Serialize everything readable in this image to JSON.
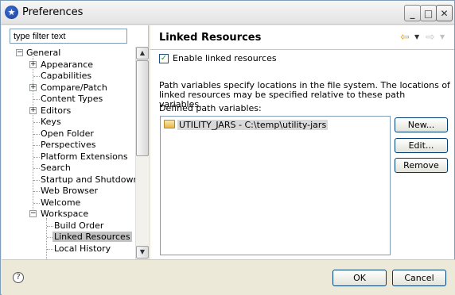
{
  "window": {
    "title": "Preferences"
  },
  "filter": {
    "value": "type filter text"
  },
  "tree": {
    "items": [
      {
        "label": "General",
        "level": 0,
        "expander": "−"
      },
      {
        "label": "Appearance",
        "level": 1,
        "expander": "+"
      },
      {
        "label": "Capabilities",
        "level": 1
      },
      {
        "label": "Compare/Patch",
        "level": 1,
        "expander": "+"
      },
      {
        "label": "Content Types",
        "level": 1
      },
      {
        "label": "Editors",
        "level": 1,
        "expander": "+"
      },
      {
        "label": "Keys",
        "level": 1
      },
      {
        "label": "Open Folder",
        "level": 1
      },
      {
        "label": "Perspectives",
        "level": 1
      },
      {
        "label": "Platform Extensions",
        "level": 1
      },
      {
        "label": "Search",
        "level": 1
      },
      {
        "label": "Startup and Shutdown",
        "level": 1
      },
      {
        "label": "Web Browser",
        "level": 1
      },
      {
        "label": "Welcome",
        "level": 1
      },
      {
        "label": "Workspace",
        "level": 1,
        "expander": "−"
      },
      {
        "label": "Build Order",
        "level": 2
      },
      {
        "label": "Linked Resources",
        "level": 2,
        "selected": true
      },
      {
        "label": "Local History",
        "level": 2
      }
    ]
  },
  "page": {
    "title": "Linked Resources",
    "enable_checkbox_label": "Enable linked resources",
    "enable_checked": true,
    "description": "Path variables specify locations in the file system. The locations of linked resources may be specified relative to these path variables.",
    "defined_label": "Defined path variables:",
    "variables": [
      {
        "text": "UTILITY_JARS - C:\\temp\\utility-jars"
      }
    ],
    "buttons": {
      "new": "New...",
      "edit": "Edit...",
      "remove": "Remove"
    }
  },
  "footer": {
    "ok": "OK",
    "cancel": "Cancel"
  }
}
